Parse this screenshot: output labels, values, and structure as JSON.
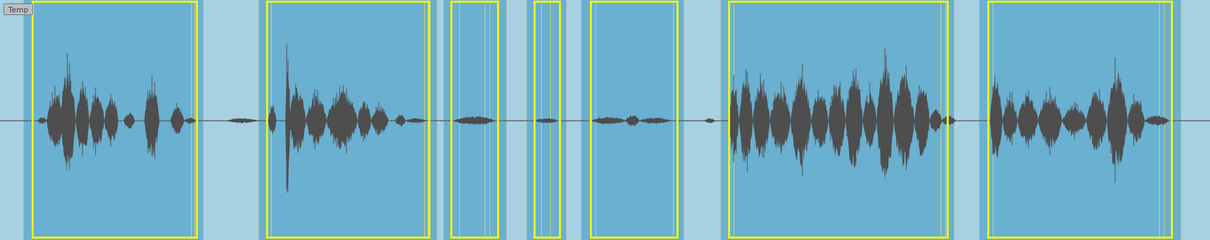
{
  "track": {
    "label": "Temp",
    "colors": {
      "background": "#a8d0e3",
      "region": "#6ab0d1",
      "selection_border": "#f2f20e",
      "waveform": "#4d4d4d"
    }
  }
}
